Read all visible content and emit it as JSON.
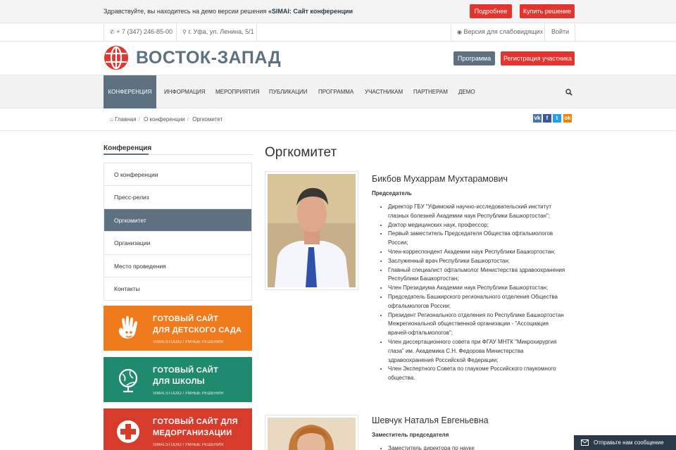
{
  "demobar": {
    "text_prefix": "Здравствуйте, вы находитесь на демо версии решения",
    "text_product": "«SIMAI: Сайт конференции",
    "btn_more": "Подробнее",
    "btn_buy": "Купить решение"
  },
  "contacts": {
    "phone": "+ 7 (347) 246-85-00",
    "address": "г. Уфа, ул. Ленина, 5/1",
    "accessibility": "Версия для слабовидящих",
    "login": "Войти"
  },
  "header": {
    "logo_text": "ВОСТОК-ЗАПАД",
    "btn_program": "Программа",
    "btn_register": "Регистрация участника"
  },
  "nav": {
    "items": [
      "Конференция",
      "Информация",
      "Мероприятия",
      "Публикации",
      "Программа",
      "Участникам",
      "Партнерам",
      "Демо"
    ]
  },
  "breadcrumb": [
    "Главная",
    "О конференции",
    "Оргкомитет"
  ],
  "social": [
    "vk",
    "f",
    "t",
    "ok"
  ],
  "sidebar": {
    "title": "Конференция",
    "items": [
      "О конференции",
      "Пресс-релиз",
      "Оргкомитет",
      "Организации",
      "Место проведения",
      "Контакты"
    ]
  },
  "banners": [
    {
      "line1": "ГОТОВЫЙ САЙТ",
      "line2": "ДЛЯ ДЕТСКОГО САДА",
      "sub": "SIMAI.STUDIO / УМНЫЕ РЕШЕНИЯ",
      "color": "#f07b1d"
    },
    {
      "line1": "ГОТОВЫЙ САЙТ",
      "line2": "ДЛЯ ШКОЛЫ",
      "sub": "SIMAI.STUDIO / УМНЫЕ РЕШЕНИЯ",
      "color": "#1f8a6d"
    },
    {
      "line1": "ГОТОВЫЙ САЙТ ДЛЯ",
      "line2": "МЕДОРГАНИЗАЦИИ",
      "sub": "SIMAI.STUDIO / УМНЫЕ РЕШЕНИЯ",
      "color": "#d63b2b"
    }
  ],
  "main": {
    "title": "Оргкомитет",
    "persons": [
      {
        "name": "Бикбов Мухаррам Мухтарамович",
        "role": "Председатель",
        "bio": [
          "Директор ГБУ \"Уфимский научно-исследовательский институт глазных болезней Академии наук Республики Башкортостан\";",
          "Доктор медицинских наук, профессор;",
          "Первый заместитель Председателя Общества офтальмологов России;",
          "Член-корреспондент Академии наук Республики Башкортостан;",
          "Заслуженный врач Республики Башкортостан;",
          "Главный специалист офтальмолог Министерства здравоохранения Республики Башкортостан;",
          "Член Президиума Академии наук Республики Башкортостан;",
          "Председатель Башкирского регионального отделения Общества офтальмологов России;",
          "Президент Регионального отделения по Республике Башкортостан Межрегиональной общественной организации - \"Ассоциация врачей-офтальмологов\";",
          "Член диссертационного совета при ФГАУ МНТК \"Микрохирургия глаза\" им. Академика С.Н. Федорова Министерства здравоохранения Российской Федерации;",
          "Член Экспертного Совета по глаукоме Российского глаукомного общества."
        ]
      },
      {
        "name": "Шевчук Наталья Евгеньевна",
        "role": "Заместитель председателя",
        "bio": [
          "Заместитель директора по науке"
        ]
      }
    ]
  },
  "message_button": "Отправьте нам сообщение"
}
